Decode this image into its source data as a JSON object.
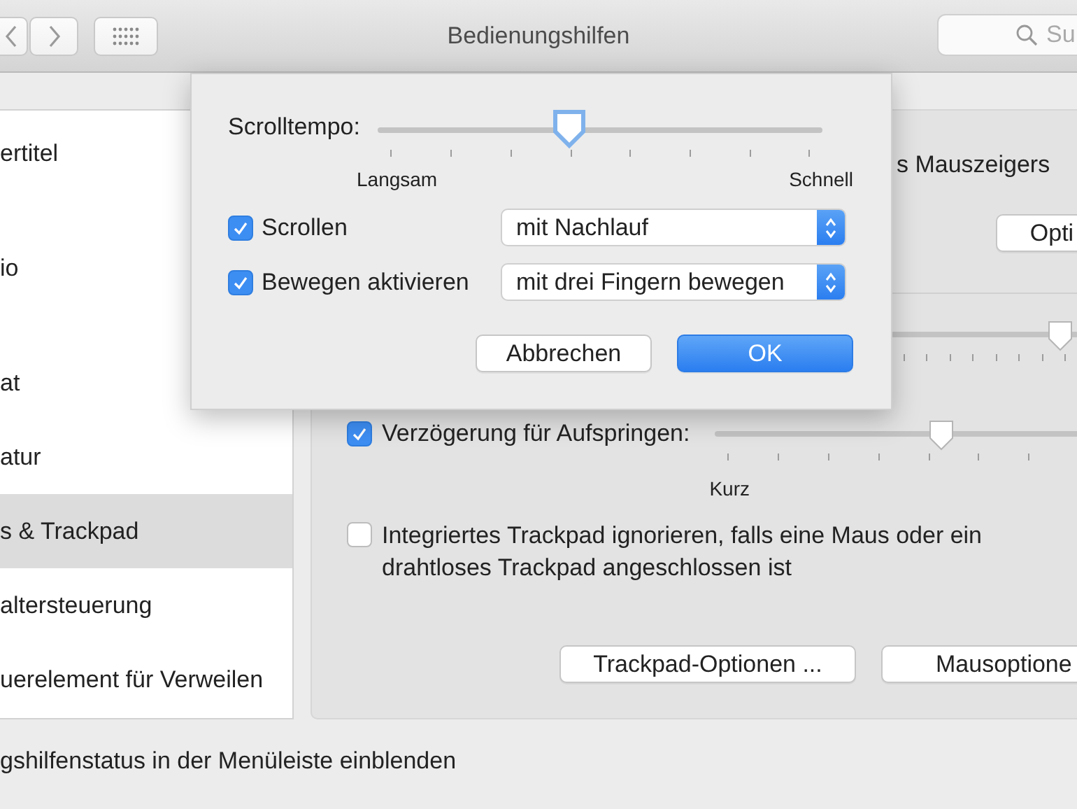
{
  "window": {
    "title": "Bedienungshilfen"
  },
  "toolbar": {
    "search": {
      "placeholder": "Su"
    }
  },
  "sidebar": {
    "items": [
      {
        "label": "ertitel",
        "selected": false
      },
      {
        "label": "io",
        "selected": false
      },
      {
        "label": "at",
        "selected": false
      },
      {
        "label": "atur",
        "selected": false
      },
      {
        "label": "s & Trackpad",
        "selected": true
      },
      {
        "label": "altersteuerung",
        "selected": false
      },
      {
        "label": "uerelement für Verweilen",
        "selected": false
      }
    ]
  },
  "panel": {
    "pointer_text": "s Mauszeigers",
    "options_button": "Opti",
    "slider": {
      "level": 0.9
    },
    "popup_delay": {
      "label": "Verzögerung für Aufspringen:",
      "checked": true,
      "level": 0.6,
      "min_label": "Kurz"
    },
    "ignore_trackpad": {
      "label": "Integriertes Trackpad ignorieren, falls eine Maus oder ein drahtloses Trackpad angeschlossen ist",
      "checked": false
    },
    "buttons": [
      "Trackpad-Optionen ...",
      "Mausoptione"
    ]
  },
  "status_option": {
    "label": "gshilfenstatus in der Menüleiste einblenden"
  },
  "sheet": {
    "speed": {
      "label": "Scrolltempo:",
      "level": 0.43,
      "min_label": "Langsam",
      "max_label": "Schnell"
    },
    "options": [
      {
        "label": "Scrollen",
        "checked": true,
        "value": "mit Nachlauf"
      },
      {
        "label": "Bewegen aktivieren",
        "checked": true,
        "value": "mit drei Fingern bewegen"
      }
    ],
    "buttons": [
      {
        "label": "Abbrechen",
        "kind": "cancel"
      },
      {
        "label": "OK",
        "kind": "default"
      }
    ]
  }
}
